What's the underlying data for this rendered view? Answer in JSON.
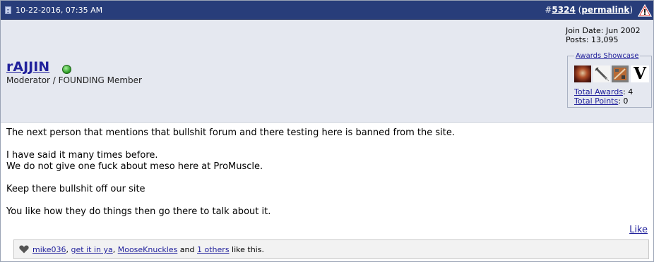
{
  "header": {
    "date": "10-22-2016, 07:35 AM",
    "post_number_prefix": "#",
    "post_number": "5324",
    "permalink_open": "(",
    "permalink": "permalink",
    "permalink_close": ")",
    "report_icon": "warning-triangle-icon",
    "bar_color": "#283d7a"
  },
  "user": {
    "name": "rAJJIN",
    "title": "Moderator / FOUNDING Member",
    "status_icon": "online-dot-icon",
    "join_date": "Join Date: Jun 2002",
    "posts": "Posts: 13,095"
  },
  "awards": {
    "showcase_label": "Awards Showcase",
    "icons": [
      "award-emblem-icon",
      "award-syringe-icon",
      "award-camo-icon",
      "award-letter-v-icon"
    ],
    "v_letter": "V",
    "total_awards_label": "Total Awards",
    "total_awards_value": ": 4",
    "total_points_label": "Total Points",
    "total_points_value": ": 0"
  },
  "message": {
    "lines": [
      "The next person that mentions that bullshit forum and there testing here is banned from the site.",
      "I have said it many times before.",
      "We do not give one fuck about meso here at ProMuscle.",
      "Keep there bullshit off our site",
      "You like how they do things then go there to talk about it."
    ]
  },
  "like": {
    "like_label": "Like",
    "likers": [
      "mike036",
      "get it in ya",
      "MooseKnuckles"
    ],
    "sep1": ", ",
    "sep2": ", ",
    "and_text": " and ",
    "others_link": "1 others",
    "suffix": " like this.",
    "icon": "heart-icon"
  }
}
